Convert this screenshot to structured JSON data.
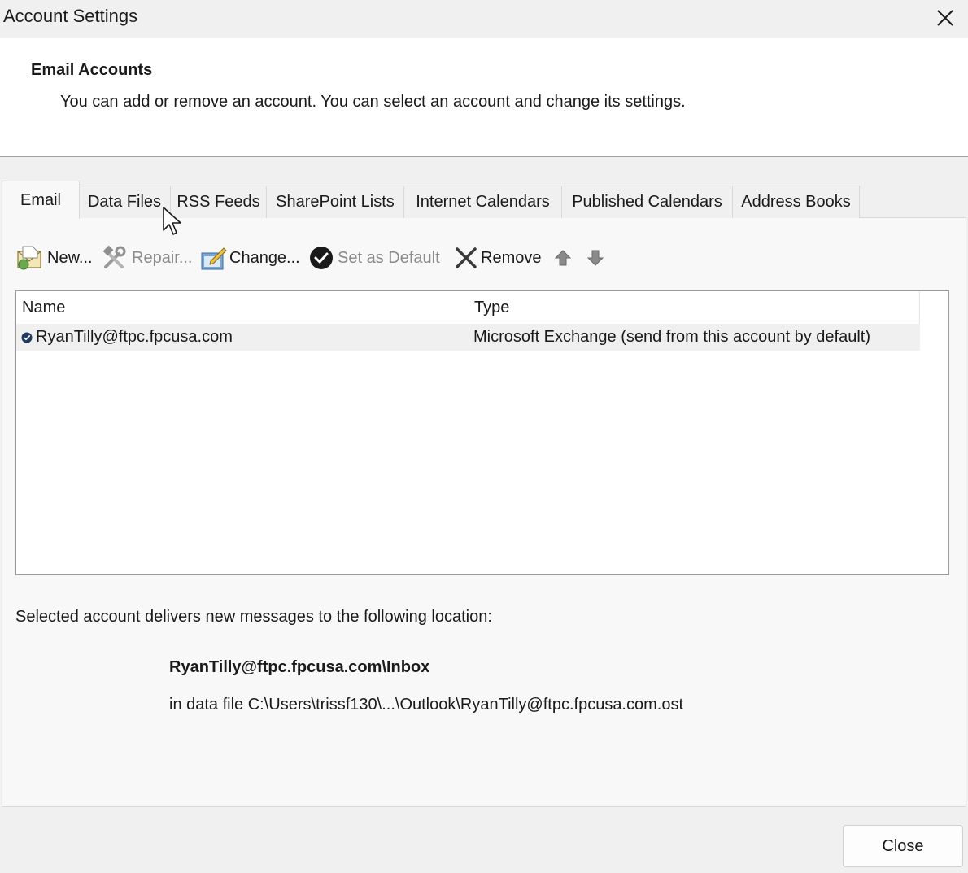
{
  "window": {
    "title": "Account Settings"
  },
  "header": {
    "title": "Email Accounts",
    "description": "You can add or remove an account. You can select an account and change its settings."
  },
  "tabs": [
    {
      "label": "Email",
      "active": true
    },
    {
      "label": "Data Files",
      "active": false
    },
    {
      "label": "RSS Feeds",
      "active": false
    },
    {
      "label": "SharePoint Lists",
      "active": false
    },
    {
      "label": "Internet Calendars",
      "active": false
    },
    {
      "label": "Published Calendars",
      "active": false
    },
    {
      "label": "Address Books",
      "active": false
    }
  ],
  "toolbar": {
    "new_label": "New...",
    "repair_label": "Repair...",
    "change_label": "Change...",
    "set_default_label": "Set as Default",
    "remove_label": "Remove",
    "move_up_icon": "up-arrow-icon",
    "move_down_icon": "down-arrow-icon"
  },
  "accounts_table": {
    "columns": [
      "Name",
      "Type"
    ],
    "rows": [
      {
        "name": "RyanTilly@ftpc.fpcusa.com",
        "type": "Microsoft Exchange (send from this account by default)",
        "default": true,
        "selected": true
      }
    ]
  },
  "delivery": {
    "label": "Selected account delivers new messages to the following location:",
    "location": "RyanTilly@ftpc.fpcusa.com\\Inbox",
    "data_file": "in data file C:\\Users\\trissf130\\...\\Outlook\\RyanTilly@ftpc.fpcusa.com.ost"
  },
  "buttons": {
    "close_label": "Close"
  },
  "colors": {
    "window_bg": "#f0f0f0",
    "header_bg": "#ffffff",
    "selected_row_bg": "#f0f0f0",
    "default_badge": "#1f3b63"
  }
}
